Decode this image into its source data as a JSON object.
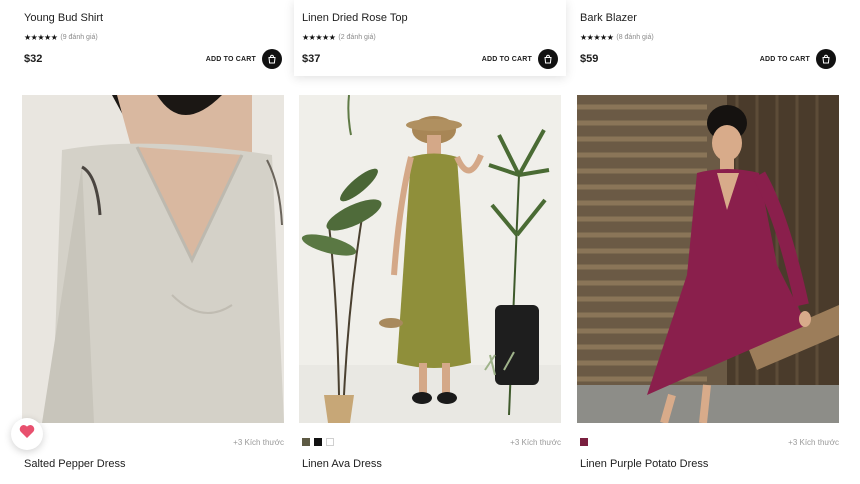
{
  "top_products": [
    {
      "name": "Young Bud Shirt",
      "stars": "★★★★★",
      "reviews": "(9 đánh giá)",
      "price": "$32",
      "cart_label": "ADD TO CART"
    },
    {
      "name": "Linen Dried Rose Top",
      "stars": "★★★★★",
      "reviews": "(2 đánh giá)",
      "price": "$37",
      "cart_label": "ADD TO CART"
    },
    {
      "name": "Bark Blazer",
      "stars": "★★★★★",
      "reviews": "(8 đánh giá)",
      "price": "$59",
      "cart_label": "ADD TO CART"
    }
  ],
  "bottom_products": [
    {
      "name": "Salted Pepper Dress",
      "sizes": "+3 Kích thước",
      "swatches": []
    },
    {
      "name": "Linen Ava Dress",
      "sizes": "+3 Kích thước",
      "swatches": [
        "#5d5a44",
        "#111111",
        "#ffffff"
      ]
    },
    {
      "name": "Linen Purple Potato Dress",
      "sizes": "+3 Kích thước",
      "swatches": [
        "#7a1f3f"
      ]
    }
  ],
  "icons": {
    "cart": "shopping-bag-icon",
    "wishlist": "heart-icon"
  },
  "colors": {
    "accent": "#111111",
    "wishlist": "#e8506e",
    "muted_text": "#9a9a9a"
  }
}
